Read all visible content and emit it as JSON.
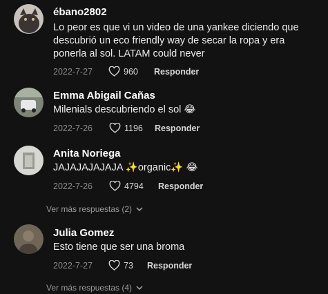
{
  "colors": {
    "background": "#121212",
    "username": "#ffffff",
    "text": "#ececec",
    "meta": "#8a8a8a"
  },
  "comments": [
    {
      "username": "ébano2802",
      "text": "Lo peor es que vi un video de una yankee diciendo que descubrió un eco friendly way de secar la ropa y era ponerla al sol. LATAM could never",
      "date": "2022-7-27",
      "likes": "960",
      "reply_label": "Responder"
    },
    {
      "username": "Emma Abigail Cañas",
      "text": "Milenials descubriendo el sol",
      "emoji": "😂",
      "date": "2022-7-26",
      "likes": "1196",
      "reply_label": "Responder"
    },
    {
      "username": "Anita Noriega",
      "text_a": "JAJAJAJAJAJA ",
      "text_b": "organic",
      "sparkle": "✨",
      "emoji": "😂",
      "date": "2022-7-26",
      "likes": "4794",
      "reply_label": "Responder",
      "more_replies": "Ver más respuestas (2)"
    },
    {
      "username": "Julia Gomez",
      "text": "Esto tiene que ser una broma",
      "date": "2022-7-27",
      "likes": "73",
      "reply_label": "Responder",
      "more_replies": "Ver más respuestas (4)"
    }
  ],
  "icons": {
    "like": "heart-outline-icon",
    "expand": "chevron-down-icon"
  }
}
